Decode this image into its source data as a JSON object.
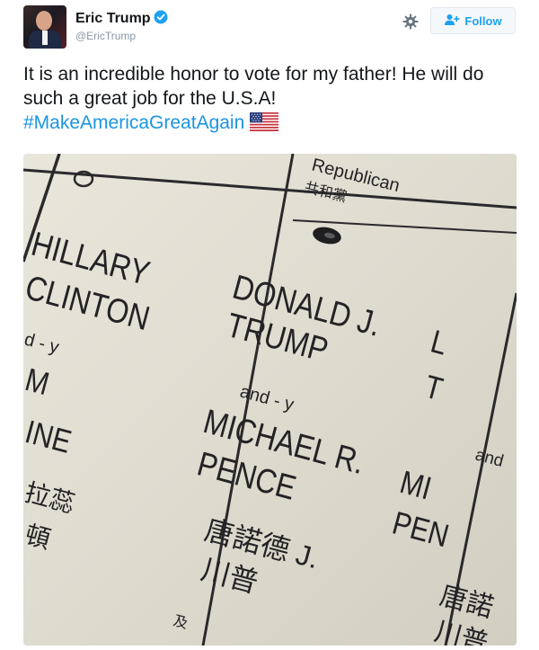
{
  "user": {
    "name": "Eric Trump",
    "handle": "@EricTrump"
  },
  "actions": {
    "follow_label": "Follow"
  },
  "tweet": {
    "text": "It is an incredible honor to vote for my father! He will do such a great job for the U.S.A!",
    "hashtag": "#MakeAmericaGreatAgain"
  },
  "ballot": {
    "party_en": "Republican",
    "party_zh": "共和黨",
    "left_name_1": "HILLARY",
    "left_name_2": "CLINTON",
    "left_and": "d - y",
    "left_frag_1": "M",
    "left_frag_2": "INE",
    "left_zh_1": "拉蕊",
    "left_zh_2": "頓",
    "main_name_1": "DONALD J.",
    "main_name_2": "TRUMP",
    "main_and": "and - y",
    "vp_name_1": "MICHAEL R.",
    "vp_name_2": "PENCE",
    "main_zh_1": "唐諾德 J.",
    "main_zh_2": "川普",
    "small_zh": "及",
    "right_frag_1": "L",
    "right_frag_2": "T",
    "right_and": "and",
    "right_frag_3": "MI",
    "right_frag_4": "PEN",
    "right_zh_1": "唐諾",
    "right_zh_2": "川普"
  },
  "colors": {
    "link": "#1b95e0",
    "verified": "#1da1f2",
    "muted": "#8899a6"
  }
}
